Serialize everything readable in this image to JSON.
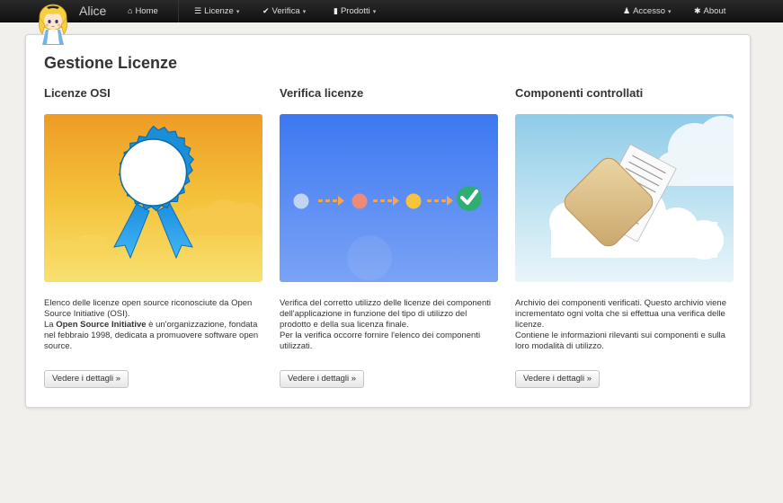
{
  "navbar": {
    "brand": "Alice",
    "items": [
      {
        "label": "Home",
        "icon": "home-icon"
      },
      {
        "label": "Licenze",
        "icon": "list-icon"
      },
      {
        "label": "Verifica",
        "icon": "check-icon"
      },
      {
        "label": "Prodotti",
        "icon": "file-icon"
      }
    ],
    "right": [
      {
        "label": "Accesso",
        "icon": "user-icon"
      },
      {
        "label": "About",
        "icon": "asterisk-icon"
      }
    ],
    "caret": "▾"
  },
  "main": {
    "title": "Gestione Licenze",
    "columns": [
      {
        "title": "Licenze OSI",
        "text1": "Elenco delle licenze open source riconosciute da Open Source Initiative (OSI).",
        "text2_pre": "La ",
        "text2_bold": "Open Source Initiative",
        "text2_post": " è un'organizzazione, fondata nel febbraio 1998, dedicata a promuovere software open source.",
        "button": "Vedere i dettagli »"
      },
      {
        "title": "Verifica licenze",
        "text1": "Verifica del corretto utilizzo delle licenze dei componenti dell'applicazione in funzione del tipo di utilizzo del prodotto e della sua licenza finale.",
        "text2": "Per la verifica occorre fornire l'elenco dei componenti utilizzati.",
        "button": "Vedere i dettagli »"
      },
      {
        "title": "Componenti controllati",
        "text1": "Archivio dei componenti verificati. Questo archivio viene incrementato ogni volta che si effettua una verifica delle licenze.",
        "text2": "Contiene le informazioni rilevanti sui componenti e sulla loro modalità di utilizzo.",
        "button": "Vedere i dettagli »"
      }
    ]
  },
  "colors": {
    "navbar": "#1b1b1b",
    "orange": "#f0a830",
    "blue": "#4a7ef0",
    "skyblue": "#bfe2f2"
  }
}
